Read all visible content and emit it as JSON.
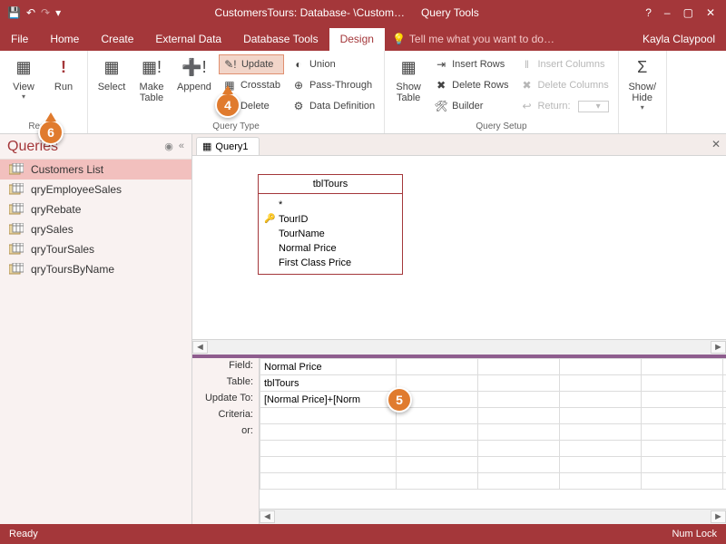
{
  "titlebar": {
    "app_title": "CustomersTours: Database- \\Custom…",
    "context_tab": "Query Tools",
    "help": "?",
    "min": "–",
    "max": "▢",
    "close": "✕"
  },
  "menubar": {
    "items": [
      "File",
      "Home",
      "Create",
      "External Data",
      "Database Tools",
      "Design"
    ],
    "active_index": 5,
    "tell_me": "Tell me what you want to do…",
    "user": "Kayla Claypool"
  },
  "ribbon": {
    "results": {
      "label": "Results",
      "view": "View",
      "run": "Run"
    },
    "querytype": {
      "label": "Query Type",
      "select": "Select",
      "make": "Make\nTable",
      "append": "Append",
      "update": "Update",
      "crosstab": "Crosstab",
      "delete": "Delete",
      "union": "Union",
      "passthrough": "Pass-Through",
      "datadef": "Data Definition"
    },
    "showtable": {
      "label": "",
      "show": "Show\nTable"
    },
    "querysetup": {
      "label": "Query Setup",
      "insertrows": "Insert Rows",
      "deleterows": "Delete Rows",
      "builder": "Builder",
      "insertcols": "Insert Columns",
      "deletecols": "Delete Columns",
      "return": "Return:"
    },
    "showhide": {
      "label": "",
      "btn": "Show/\nHide"
    }
  },
  "nav": {
    "header": "Queries",
    "items": [
      "Customers List",
      "qryEmployeeSales",
      "qryRebate",
      "qrySales",
      "qryTourSales",
      "qryToursByName"
    ],
    "selected_index": 0
  },
  "doc": {
    "tab": "Query1"
  },
  "tablebox": {
    "title": "tblTours",
    "star": "*",
    "fields": [
      "TourID",
      "TourName",
      "Normal Price",
      "First Class Price"
    ],
    "key_index": 0
  },
  "designgrid": {
    "rows": [
      "Field:",
      "Table:",
      "Update To:",
      "Criteria:",
      "or:"
    ],
    "col1": [
      "Normal Price",
      "tblTours",
      "[Normal Price]+[Norm",
      "",
      ""
    ]
  },
  "status": {
    "left": "Ready",
    "right": "Num Lock"
  },
  "callouts": {
    "c4": "4",
    "c5": "5",
    "c6": "6"
  }
}
